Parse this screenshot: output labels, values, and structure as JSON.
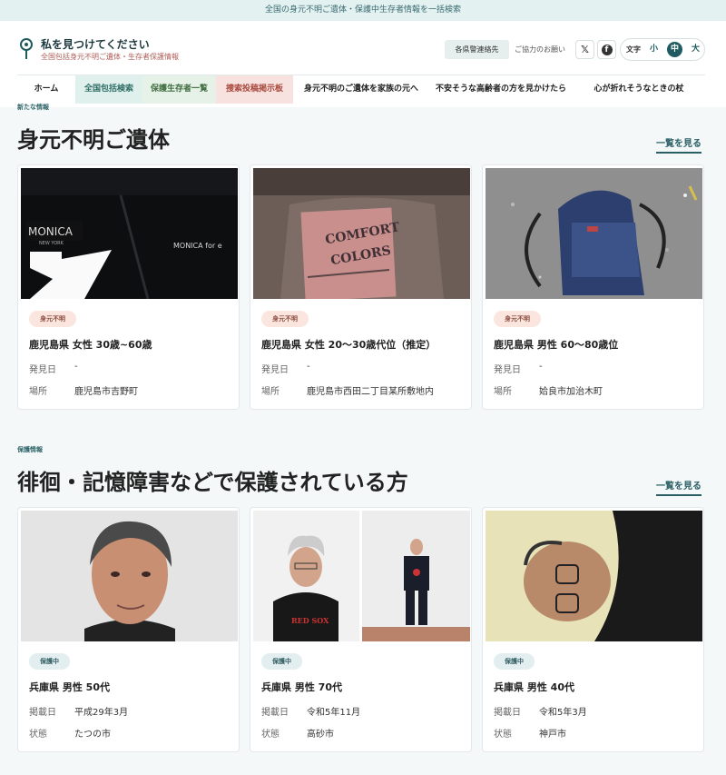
{
  "topbar": {
    "text": "全国の身元不明ご遺体・保護中生存者情報を一括検索"
  },
  "brand": {
    "title": "私を見つけてください",
    "subtitle": "全国包括身元不明ご遺体・生存者保護情報"
  },
  "header_actions": {
    "pref_button": "各県警連絡先",
    "cooperate": "ご協力のお願い",
    "x_icon": "x-icon",
    "facebook_icon": "facebook-icon",
    "text_size_label": "文字",
    "text_sizes": [
      "小",
      "中",
      "大"
    ],
    "active_text_size": "中"
  },
  "nav": {
    "items": [
      "ホーム",
      "全国包括検索",
      "保護生存者一覧",
      "捜索投稿掲示板",
      "身元不明のご遺体を家族の元へ",
      "不安そうな高齢者の方を見かけたら",
      "心が折れそうなときの杖"
    ]
  },
  "section_unknown": {
    "small_label": "新たな情報",
    "title": "身元不明ご遺体",
    "more": "一覧を見る",
    "cards": [
      {
        "tag": "身元不明",
        "title": "鹿児島県 女性 30歳~60歳",
        "k1": "発見日",
        "v1": "-",
        "k2": "場所",
        "v2": "鹿児島市吉野町",
        "img_text": "MONICA NEW YORK"
      },
      {
        "tag": "身元不明",
        "title": "鹿児島県 女性 20～30歳代位（推定）",
        "k1": "発見日",
        "v1": "-",
        "k2": "場所",
        "v2": "鹿児島市西田二丁目某所敷地内",
        "img_text": "COMFORT COLORS"
      },
      {
        "tag": "身元不明",
        "title": "鹿児島県 男性 60～80歳位",
        "k1": "発見日",
        "v1": "-",
        "k2": "場所",
        "v2": "姶良市加治木町",
        "img_text": ""
      }
    ]
  },
  "section_protect": {
    "small_label": "保護情報",
    "title": "徘徊・記憶障害などで保護されている方",
    "more": "一覧を見る",
    "cards": [
      {
        "tag": "保護中",
        "title": "兵庫県 男性 50代",
        "k1": "掲載日",
        "v1": "平成29年3月",
        "k2": "状態",
        "v2": "たつの市"
      },
      {
        "tag": "保護中",
        "title": "兵庫県 男性 70代",
        "k1": "掲載日",
        "v1": "令和5年11月",
        "k2": "状態",
        "v2": "高砂市"
      },
      {
        "tag": "保護中",
        "title": "兵庫県 男性 40代",
        "k1": "掲載日",
        "v1": "令和5年3月",
        "k2": "状態",
        "v2": "神戸市"
      }
    ]
  },
  "colors": {
    "accent": "#1f5b60",
    "background": "#f4f8f8"
  }
}
